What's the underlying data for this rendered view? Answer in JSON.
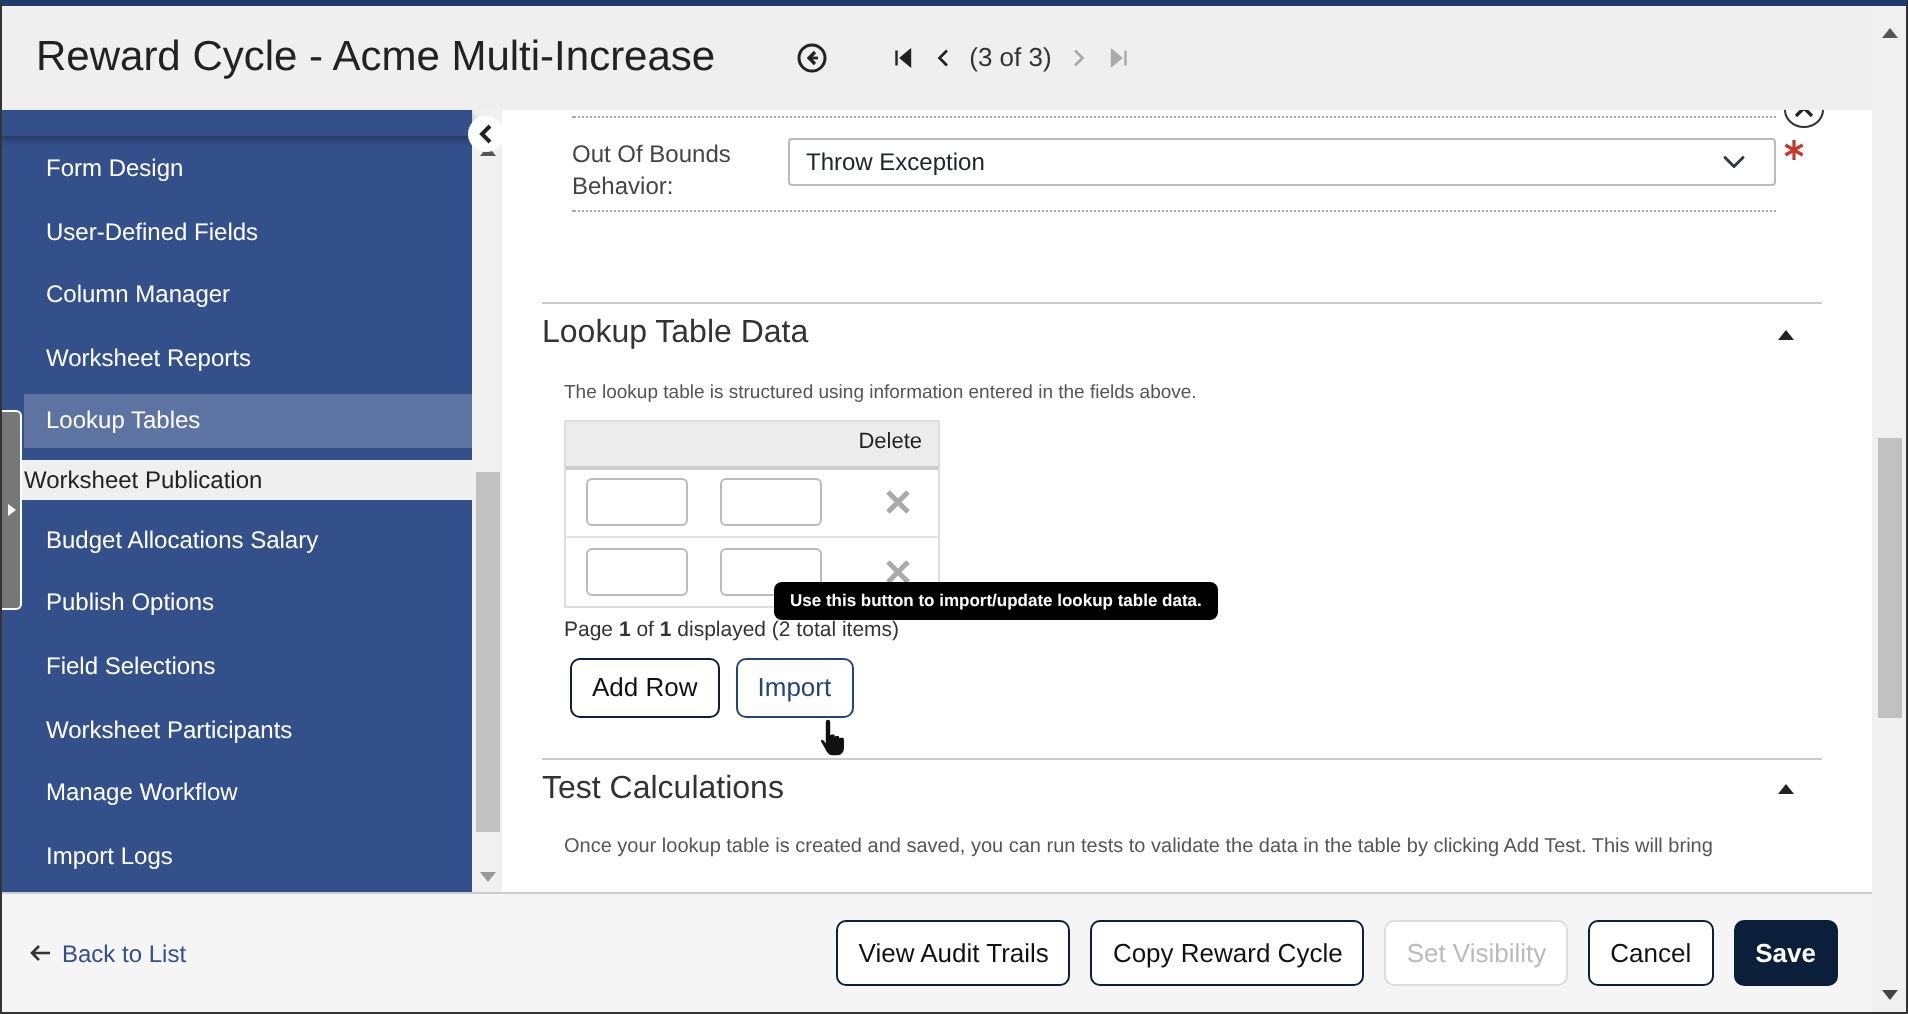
{
  "header": {
    "title": "Reward Cycle - Acme Multi-Increase",
    "pager": "(3 of 3)",
    "nav_buttons": [
      {
        "kind": "first",
        "disabled": false
      },
      {
        "kind": "prev",
        "disabled": false
      },
      {
        "kind": "next",
        "disabled": true
      },
      {
        "kind": "last",
        "disabled": true
      }
    ]
  },
  "sidebar": {
    "items": [
      {
        "label": "Form Design",
        "kind": "item",
        "selected": false
      },
      {
        "label": "User-Defined Fields",
        "kind": "item",
        "selected": false
      },
      {
        "label": "Column Manager",
        "kind": "item",
        "selected": false
      },
      {
        "label": "Worksheet Reports",
        "kind": "item",
        "selected": false
      },
      {
        "label": "Lookup Tables",
        "kind": "item",
        "selected": true
      },
      {
        "label": "Worksheet Publication",
        "kind": "group",
        "selected": false
      },
      {
        "label": "Budget Allocations Salary",
        "kind": "item",
        "selected": false
      },
      {
        "label": "Publish Options",
        "kind": "item",
        "selected": false
      },
      {
        "label": "Field Selections",
        "kind": "item",
        "selected": false
      },
      {
        "label": "Worksheet Participants",
        "kind": "item",
        "selected": false
      },
      {
        "label": "Manage Workflow",
        "kind": "item",
        "selected": false
      },
      {
        "label": "Import Logs",
        "kind": "item",
        "selected": false
      }
    ]
  },
  "field": {
    "label": "Out Of Bounds Behavior:",
    "value": "Throw Exception",
    "required": true
  },
  "lookup_section": {
    "title": "Lookup Table Data",
    "expanded": true,
    "description": "The lookup table is structured using information entered in the fields above.",
    "table": {
      "columns": [
        "Delete"
      ],
      "rows": [
        {
          "deletable": true
        },
        {
          "deletable": true
        }
      ]
    },
    "pagination": "Page **1** of **1** displayed (2 total items)",
    "buttons": [
      {
        "label": "Add Row",
        "hovered": false
      },
      {
        "label": "Import",
        "hovered": true
      }
    ],
    "tooltip": "Use this button to import/update lookup table data."
  },
  "test_section": {
    "title": "Test Calculations",
    "expanded": true,
    "description": "Once your lookup table is created and saved, you can run tests to validate the data in the table by clicking Add Test. This will bring"
  },
  "footer": {
    "back_link": "Back to List",
    "buttons": [
      {
        "label": "View Audit Trails",
        "kind": "outline",
        "disabled": false
      },
      {
        "label": "Copy Reward Cycle",
        "kind": "outline",
        "disabled": false
      },
      {
        "label": "Set Visibility",
        "kind": "outline",
        "disabled": true
      },
      {
        "label": "Cancel",
        "kind": "outline",
        "disabled": false
      },
      {
        "label": "Save",
        "kind": "primary",
        "disabled": false
      }
    ]
  }
}
